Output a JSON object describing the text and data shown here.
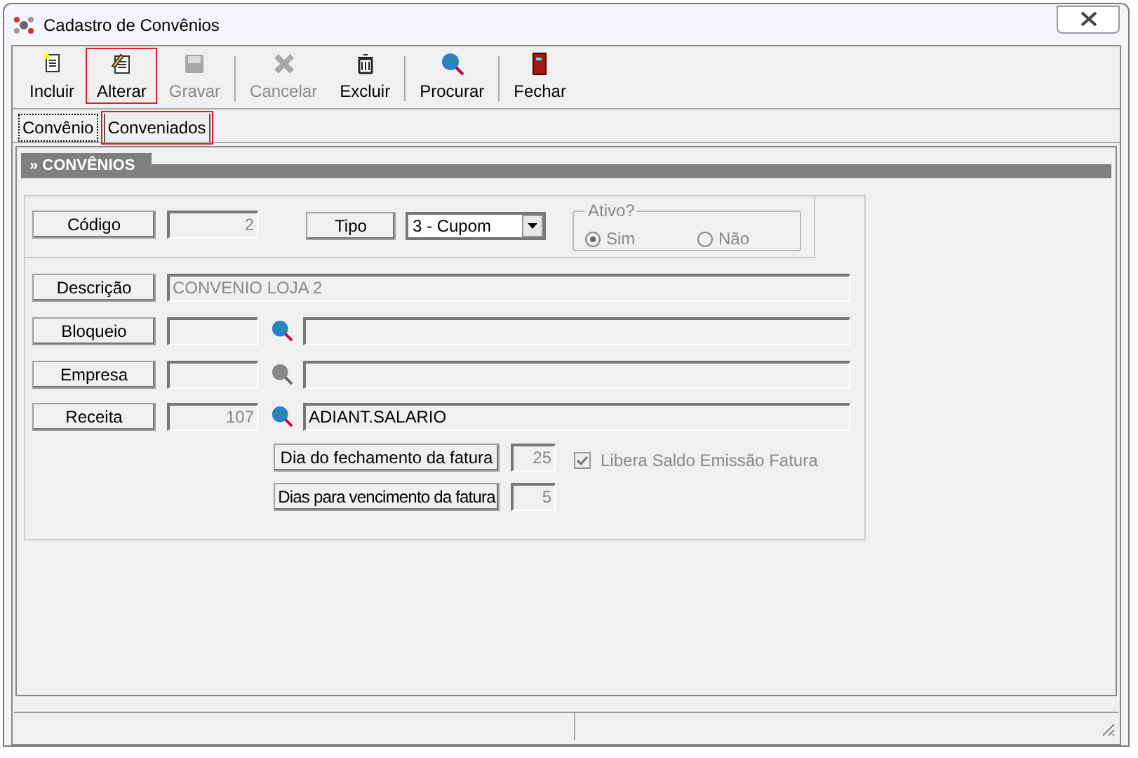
{
  "window": {
    "title": "Cadastro de Convênios"
  },
  "toolbar": [
    {
      "label": "Incluir",
      "kind": "new",
      "disabled": false,
      "highlighted": false,
      "separator_after": false
    },
    {
      "label": "Alterar",
      "kind": "edit",
      "disabled": false,
      "highlighted": true,
      "separator_after": false
    },
    {
      "label": "Gravar",
      "kind": "save",
      "disabled": true,
      "highlighted": false,
      "separator_after": true
    },
    {
      "label": "Cancelar",
      "kind": "cancel",
      "disabled": true,
      "highlighted": false,
      "separator_after": false
    },
    {
      "label": "Excluir",
      "kind": "delete",
      "disabled": false,
      "highlighted": false,
      "separator_after": true
    },
    {
      "label": "Procurar",
      "kind": "search",
      "disabled": false,
      "highlighted": false,
      "separator_after": true
    },
    {
      "label": "Fechar",
      "kind": "exit",
      "disabled": false,
      "highlighted": false,
      "separator_after": false
    }
  ],
  "tabs": [
    {
      "label": "Convênio",
      "selected": true,
      "highlighted": false
    },
    {
      "label": "Conveniados",
      "selected": false,
      "highlighted": true
    }
  ],
  "section": {
    "title": "» CONVÊNIOS"
  },
  "codigo": {
    "label": "Código",
    "value": "2"
  },
  "tipo": {
    "label": "Tipo",
    "value": "3 - Cupom"
  },
  "ativo": {
    "legend": "Ativo?",
    "options": [
      {
        "label": "Sim",
        "selected": true
      },
      {
        "label": "Não",
        "selected": false
      }
    ]
  },
  "descricao": {
    "label": "Descrição",
    "value": "CONVENIO LOJA 2"
  },
  "lookups": [
    {
      "label": "Bloqueio",
      "disabled": false
    },
    {
      "label": "Empresa",
      "disabled": true
    },
    {
      "label": "Receita",
      "code": "107",
      "description": "ADIANT.SALARIO",
      "disabled": false
    }
  ],
  "dia_fechamento": {
    "label": "Dia do fechamento da fatura",
    "value": "25"
  },
  "libera_saldo": {
    "label": "Libera Saldo Emissão Fatura",
    "checked": true
  },
  "dias_vencimento": {
    "label": "Dias para vencimento da fatura",
    "value": "5"
  }
}
